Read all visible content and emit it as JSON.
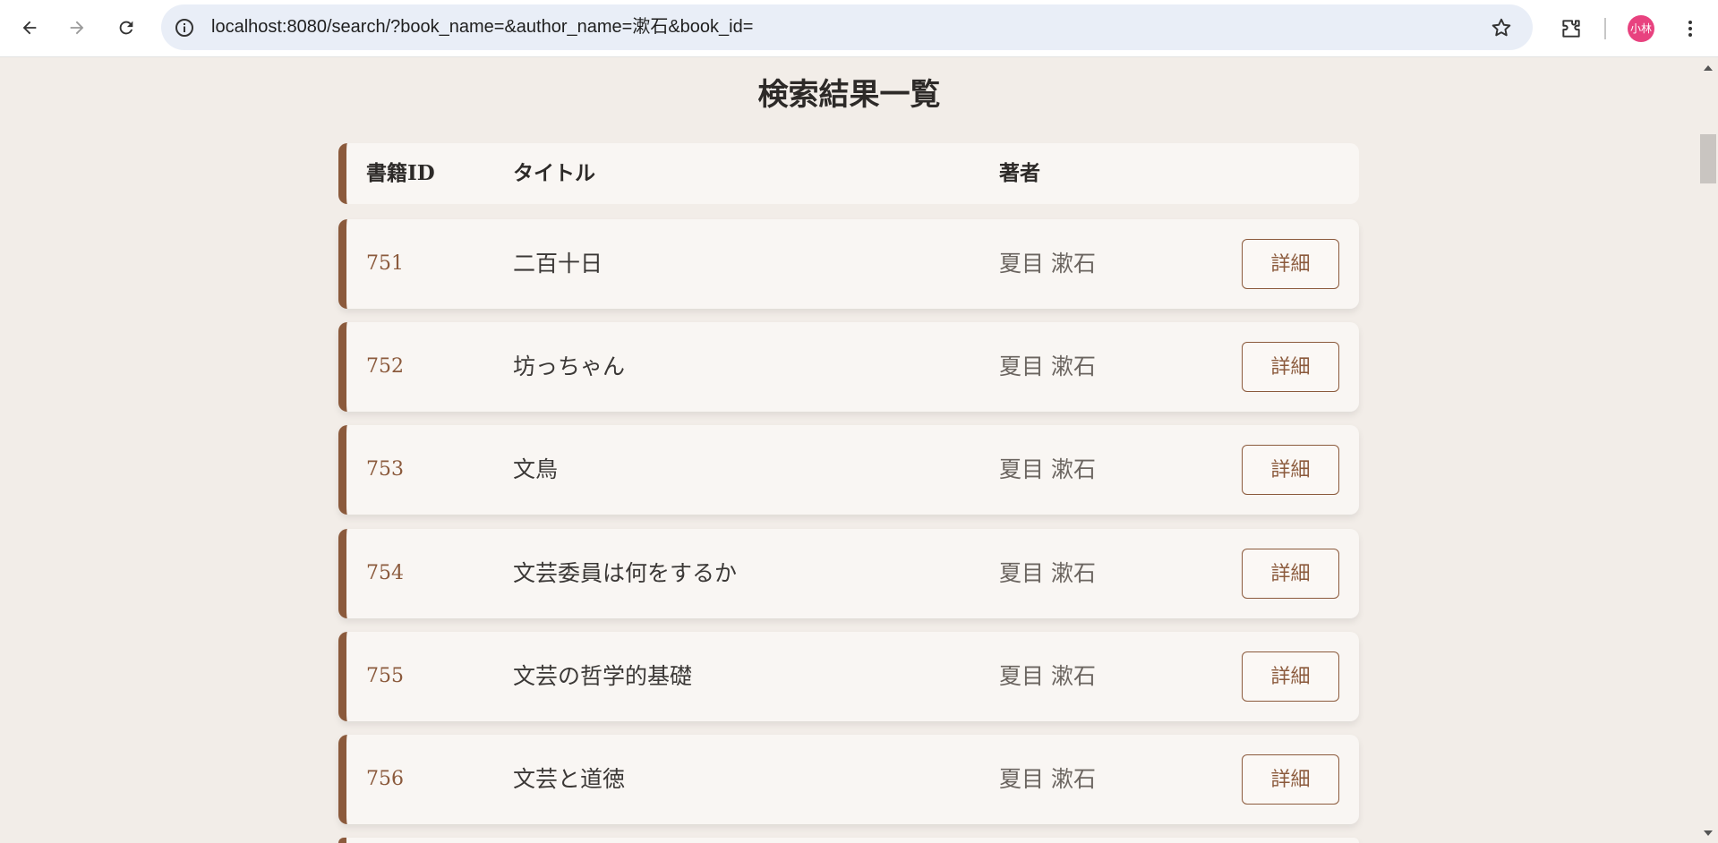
{
  "browser": {
    "url": "localhost:8080/search/?book_name=&author_name=漱石&book_id=",
    "profile_initials": "小林",
    "icons": {
      "back": "arrow-left-icon",
      "forward": "arrow-right-icon",
      "reload": "reload-icon",
      "info": "info-icon",
      "bookmark": "star-icon",
      "extensions": "puzzle-icon",
      "menu": "kebab-menu-icon"
    }
  },
  "page": {
    "title": "検索結果一覧",
    "accent_color": "#8b5a3c",
    "background_color": "#f2ede8"
  },
  "table": {
    "headers": {
      "id": "書籍ID",
      "title": "タイトル",
      "author": "著者"
    },
    "rows": [
      {
        "id": "751",
        "title": "二百十日",
        "author": "夏目 漱石",
        "action": "詳細"
      },
      {
        "id": "752",
        "title": "坊っちゃん",
        "author": "夏目 漱石",
        "action": "詳細"
      },
      {
        "id": "753",
        "title": "文鳥",
        "author": "夏目 漱石",
        "action": "詳細"
      },
      {
        "id": "754",
        "title": "文芸委員は何をするか",
        "author": "夏目 漱石",
        "action": "詳細"
      },
      {
        "id": "755",
        "title": "文芸の哲学的基礎",
        "author": "夏目 漱石",
        "action": "詳細"
      },
      {
        "id": "756",
        "title": "文芸と道徳",
        "author": "夏目 漱石",
        "action": "詳細"
      }
    ]
  }
}
